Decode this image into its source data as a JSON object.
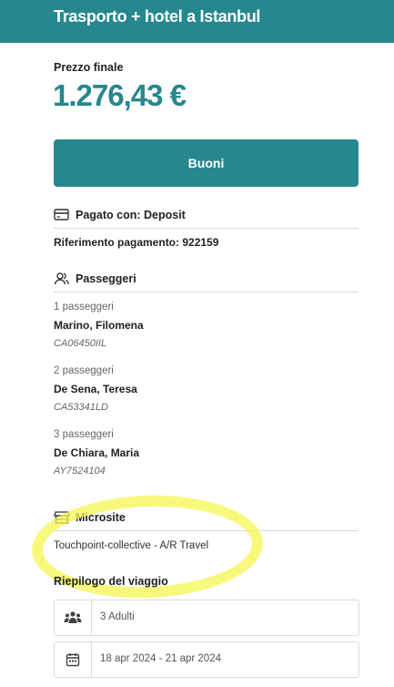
{
  "header": {
    "title": "Trasporto + hotel a Istanbul"
  },
  "price": {
    "label": "Prezzo finale",
    "value": "1.276,43 €"
  },
  "voucher_button": {
    "label": "Buoni"
  },
  "payment": {
    "heading": "Pagato con: Deposit",
    "reference": "Riferimento pagamento: 922159",
    "icon": "credit-card-icon"
  },
  "passengers": {
    "heading": "Passeggeri",
    "icon": "users-icon",
    "items": [
      {
        "index_label": "1 passeggeri",
        "name": "Marino, Filomena",
        "document": "CA06450IIL"
      },
      {
        "index_label": "2 passeggeri",
        "name": "De Sena, Teresa",
        "document": "CA53341LD"
      },
      {
        "index_label": "3 passeggeri",
        "name": "De Chiara, Maria",
        "document": "AY7524104"
      }
    ]
  },
  "microsite": {
    "heading": "Microsite",
    "icon": "store-icon",
    "value": "Touchpoint-collective - A/R Travel",
    "highlight_color": "#f5f550"
  },
  "summary": {
    "title": "Riepilogo del viaggio",
    "guests": {
      "value": "3 Adulti",
      "icon": "people-icon"
    },
    "dates": {
      "value": "18 apr 2024 - 21 apr 2024",
      "icon": "calendar-icon"
    }
  },
  "colors": {
    "accent": "#27878f"
  }
}
